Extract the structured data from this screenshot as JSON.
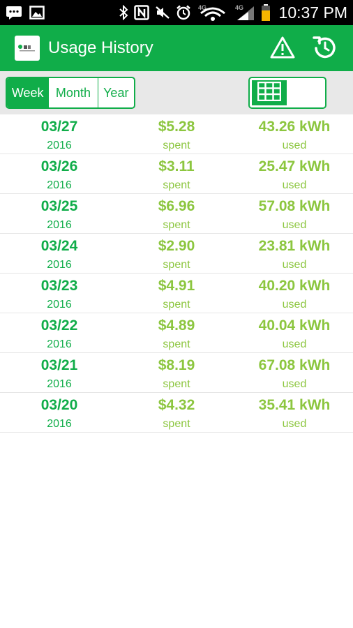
{
  "status_bar": {
    "time": "10:37 PM",
    "network_labels": [
      "4G",
      "4G"
    ],
    "icons": [
      "messages-icon",
      "image-icon",
      "bluetooth-icon",
      "nfc-icon",
      "mute-icon",
      "alarm-icon",
      "wifi-icon",
      "signal-icon",
      "battery-icon"
    ]
  },
  "app_bar": {
    "title": "Usage History",
    "logo_icon": "app-logo-icon",
    "actions": [
      "warning-icon",
      "refresh-icon"
    ]
  },
  "colors": {
    "primary": "#10ad49",
    "accent": "#8cc63f",
    "toolbar_bg": "#e8e8e8"
  },
  "period_tabs": [
    {
      "label": "Week",
      "selected": true
    },
    {
      "label": "Month",
      "selected": false
    },
    {
      "label": "Year",
      "selected": false
    }
  ],
  "view_toggle": {
    "icon": "table-grid-icon",
    "mode": "table"
  },
  "usage_rows": [
    {
      "date": "03/27",
      "year": "2016",
      "cost": "$5.28",
      "cost_label": "spent",
      "kwh": "43.26 kWh",
      "kwh_label": "used"
    },
    {
      "date": "03/26",
      "year": "2016",
      "cost": "$3.11",
      "cost_label": "spent",
      "kwh": "25.47 kWh",
      "kwh_label": "used"
    },
    {
      "date": "03/25",
      "year": "2016",
      "cost": "$6.96",
      "cost_label": "spent",
      "kwh": "57.08 kWh",
      "kwh_label": "used"
    },
    {
      "date": "03/24",
      "year": "2016",
      "cost": "$2.90",
      "cost_label": "spent",
      "kwh": "23.81 kWh",
      "kwh_label": "used"
    },
    {
      "date": "03/23",
      "year": "2016",
      "cost": "$4.91",
      "cost_label": "spent",
      "kwh": "40.20 kWh",
      "kwh_label": "used"
    },
    {
      "date": "03/22",
      "year": "2016",
      "cost": "$4.89",
      "cost_label": "spent",
      "kwh": "40.04 kWh",
      "kwh_label": "used"
    },
    {
      "date": "03/21",
      "year": "2016",
      "cost": "$8.19",
      "cost_label": "spent",
      "kwh": "67.08 kWh",
      "kwh_label": "used"
    },
    {
      "date": "03/20",
      "year": "2016",
      "cost": "$4.32",
      "cost_label": "spent",
      "kwh": "35.41 kWh",
      "kwh_label": "used"
    }
  ]
}
